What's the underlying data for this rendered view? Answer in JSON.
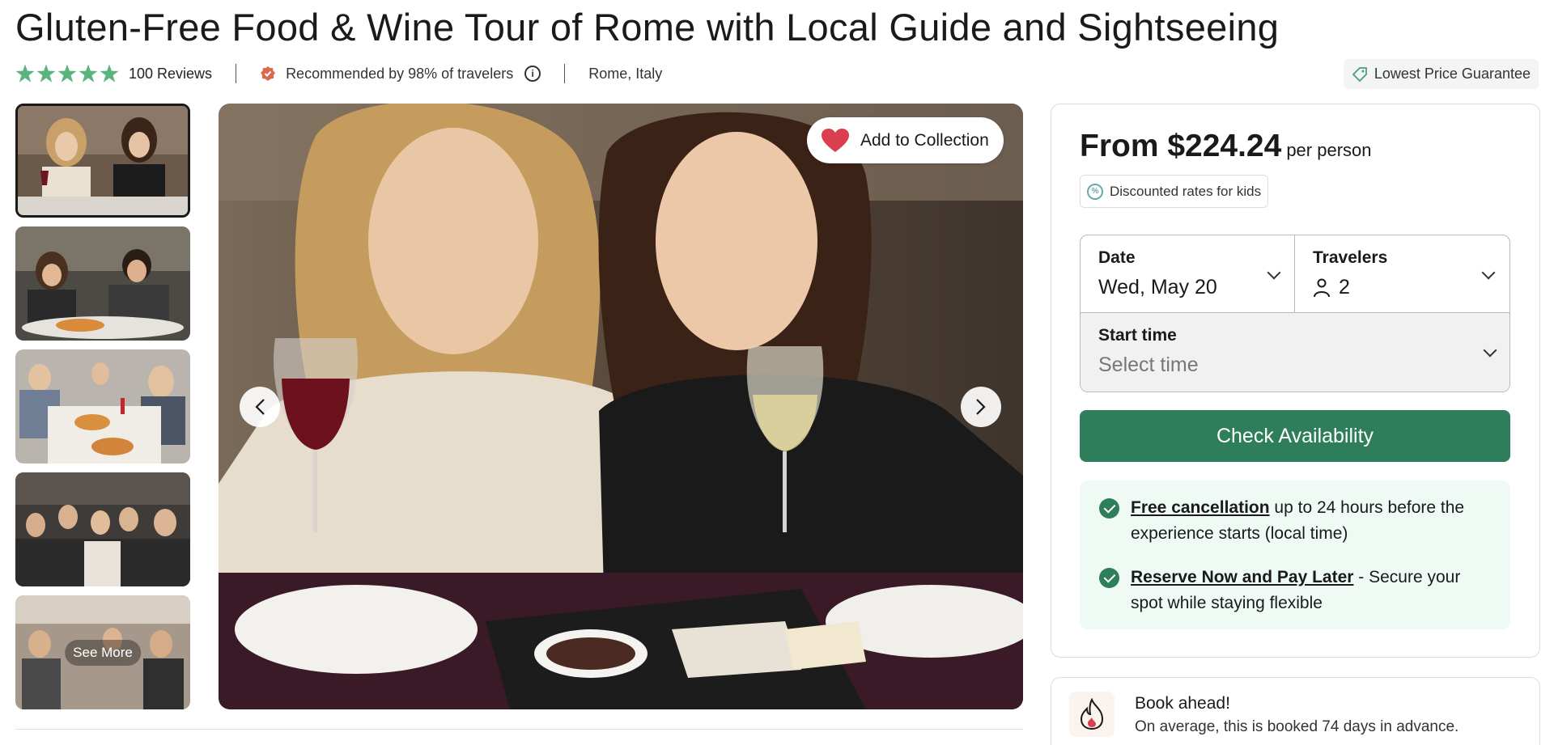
{
  "title": "Gluten-Free Food & Wine Tour of Rome with Local Guide and Sightseeing",
  "rating": {
    "stars": 5,
    "reviews_label": "100 Reviews"
  },
  "recommended_text": "Recommended by 98% of travelers",
  "location": "Rome, Italy",
  "guarantee_label": "Lowest Price Guarantee",
  "gallery": {
    "add_collection_label": "Add to Collection",
    "see_more_label": "See More",
    "thumbnails": [
      "thumb-1",
      "thumb-2",
      "thumb-3",
      "thumb-4",
      "thumb-5"
    ]
  },
  "booking": {
    "from_label": "From $224.24",
    "per_label": "per person",
    "kids_label": "Discounted rates for kids",
    "date_label": "Date",
    "date_value": "Wed, May 20",
    "travelers_label": "Travelers",
    "travelers_value": "2",
    "start_time_label": "Start time",
    "start_time_placeholder": "Select time",
    "check_button": "Check Availability",
    "perk1_link": "Free cancellation",
    "perk1_text": "up to 24 hours before the experience starts (local time)",
    "perk2_link": "Reserve Now and Pay Later",
    "perk2_text": "- Secure your spot while staying flexible"
  },
  "book_ahead": {
    "title": "Book ahead!",
    "text": "On average, this is booked 74 days in advance."
  },
  "colors": {
    "accent_green": "#2e7d5b",
    "star_green": "#5bb47e",
    "perk_bg": "#f0faf5"
  }
}
